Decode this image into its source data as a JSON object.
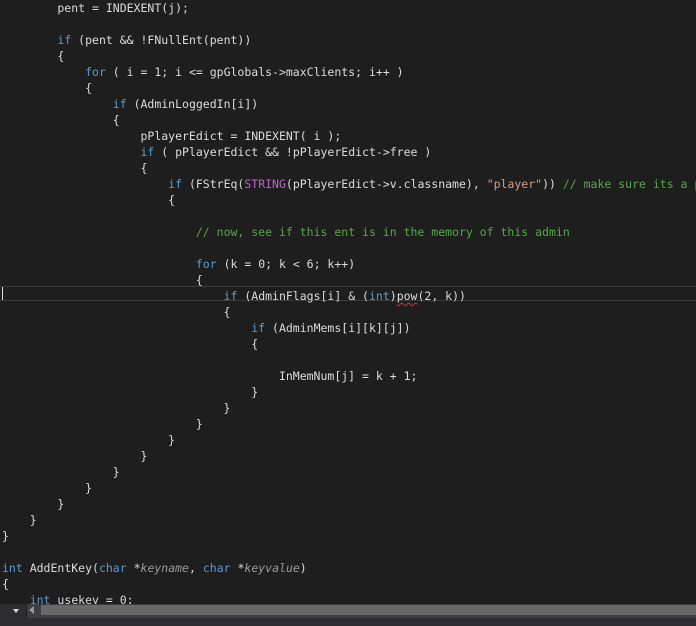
{
  "editor": {
    "lines": [
      [
        {
          "t": "        pent = INDEXENT(j);"
        }
      ],
      [
        {
          "t": ""
        }
      ],
      [
        {
          "t": "        "
        },
        {
          "t": "if",
          "c": "kw"
        },
        {
          "t": " (pent && !FNullEnt(pent))"
        }
      ],
      [
        {
          "t": "        {"
        }
      ],
      [
        {
          "t": "            "
        },
        {
          "t": "for",
          "c": "kw"
        },
        {
          "t": " ( i = 1; i <= gpGlobals->maxClients; i++ )"
        }
      ],
      [
        {
          "t": "            {"
        }
      ],
      [
        {
          "t": "                "
        },
        {
          "t": "if",
          "c": "kw"
        },
        {
          "t": " (AdminLoggedIn[i])"
        }
      ],
      [
        {
          "t": "                {"
        }
      ],
      [
        {
          "t": "                    pPlayerEdict = INDEXENT( i );"
        }
      ],
      [
        {
          "t": "                    "
        },
        {
          "t": "if",
          "c": "kw"
        },
        {
          "t": " ( pPlayerEdict && !pPlayerEdict->free )"
        }
      ],
      [
        {
          "t": "                    {"
        }
      ],
      [
        {
          "t": "                        "
        },
        {
          "t": "if",
          "c": "kw"
        },
        {
          "t": " (FStrEq("
        },
        {
          "t": "STRING",
          "c": "mac"
        },
        {
          "t": "(pPlayerEdict->v.classname), "
        },
        {
          "t": "\"player\"",
          "c": "str"
        },
        {
          "t": ")) "
        },
        {
          "t": "// make sure its a player",
          "c": "cm"
        }
      ],
      [
        {
          "t": "                        {"
        }
      ],
      [
        {
          "t": ""
        }
      ],
      [
        {
          "t": "                            "
        },
        {
          "t": "// now, see if this ent is in the memory of this admin",
          "c": "cm"
        }
      ],
      [
        {
          "t": ""
        }
      ],
      [
        {
          "t": "                            "
        },
        {
          "t": "for",
          "c": "kw"
        },
        {
          "t": " (k = 0; k < 6; k++)"
        }
      ],
      [
        {
          "t": "                            {"
        }
      ],
      [
        {
          "t": "                                "
        },
        {
          "t": "if",
          "c": "kw"
        },
        {
          "t": " (AdminFlags[i] & ("
        },
        {
          "t": "int",
          "c": "kw"
        },
        {
          "t": ")"
        },
        {
          "t": "pow",
          "c": "sq"
        },
        {
          "t": "(2, k))"
        }
      ],
      [
        {
          "t": "                                {"
        }
      ],
      [
        {
          "t": "                                    "
        },
        {
          "t": "if",
          "c": "kw"
        },
        {
          "t": " (AdminMems[i][k][j])"
        }
      ],
      [
        {
          "t": "                                    {"
        }
      ],
      [
        {
          "t": ""
        }
      ],
      [
        {
          "t": "                                        InMemNum[j] = k + 1;"
        }
      ],
      [
        {
          "t": "                                    }"
        }
      ],
      [
        {
          "t": "                                }"
        }
      ],
      [
        {
          "t": "                            }"
        }
      ],
      [
        {
          "t": "                        }"
        }
      ],
      [
        {
          "t": "                    }"
        }
      ],
      [
        {
          "t": "                }"
        }
      ],
      [
        {
          "t": "            }"
        }
      ],
      [
        {
          "t": "        }"
        }
      ],
      [
        {
          "t": "    }"
        }
      ],
      [
        {
          "t": "}"
        }
      ],
      [
        {
          "t": ""
        }
      ],
      [
        {
          "t": "int",
          "c": "kw"
        },
        {
          "t": " AddEntKey("
        },
        {
          "t": "char",
          "c": "kw"
        },
        {
          "t": " *"
        },
        {
          "t": "keyname",
          "c": "par"
        },
        {
          "t": ", "
        },
        {
          "t": "char",
          "c": "kw"
        },
        {
          "t": " *"
        },
        {
          "t": "keyvalue",
          "c": "par"
        },
        {
          "t": ")"
        }
      ],
      [
        {
          "t": "{"
        }
      ],
      [
        {
          "t": "    "
        },
        {
          "t": "int",
          "c": "kw"
        },
        {
          "t": " usekey = 0;"
        }
      ]
    ],
    "current_line_index": 18
  },
  "colors": {
    "background": "#1e1e1e",
    "text": "#dcdcdc",
    "keyword": "#569cd6",
    "string": "#d69d85",
    "comment": "#57a64a",
    "macro": "#bd63c5",
    "parameter": "#9a9a9a"
  },
  "scrollbar": {
    "zoom_icon": "chevron-down-icon",
    "scroll_left_icon": "arrow-left-icon"
  }
}
